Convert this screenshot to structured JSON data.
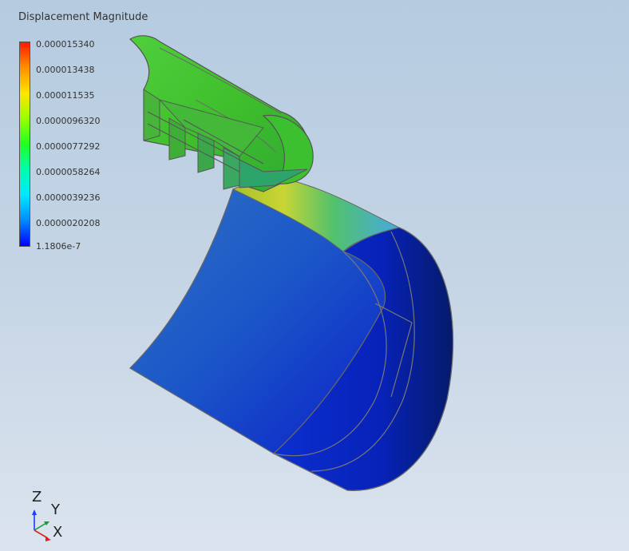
{
  "legend": {
    "title": "Displacement Magnitude",
    "labels": [
      "0.000015340",
      "0.000013438",
      "0.000011535",
      "0.0000096320",
      "0.0000077292",
      "0.0000058264",
      "0.0000039236",
      "0.0000020208",
      "1.1806e-7"
    ]
  },
  "triad": {
    "z": "Z",
    "y": "Y",
    "x": "X"
  },
  "colors": {
    "max": "#ff1a00",
    "min": "#0000ff",
    "mid": "#22ff22"
  }
}
